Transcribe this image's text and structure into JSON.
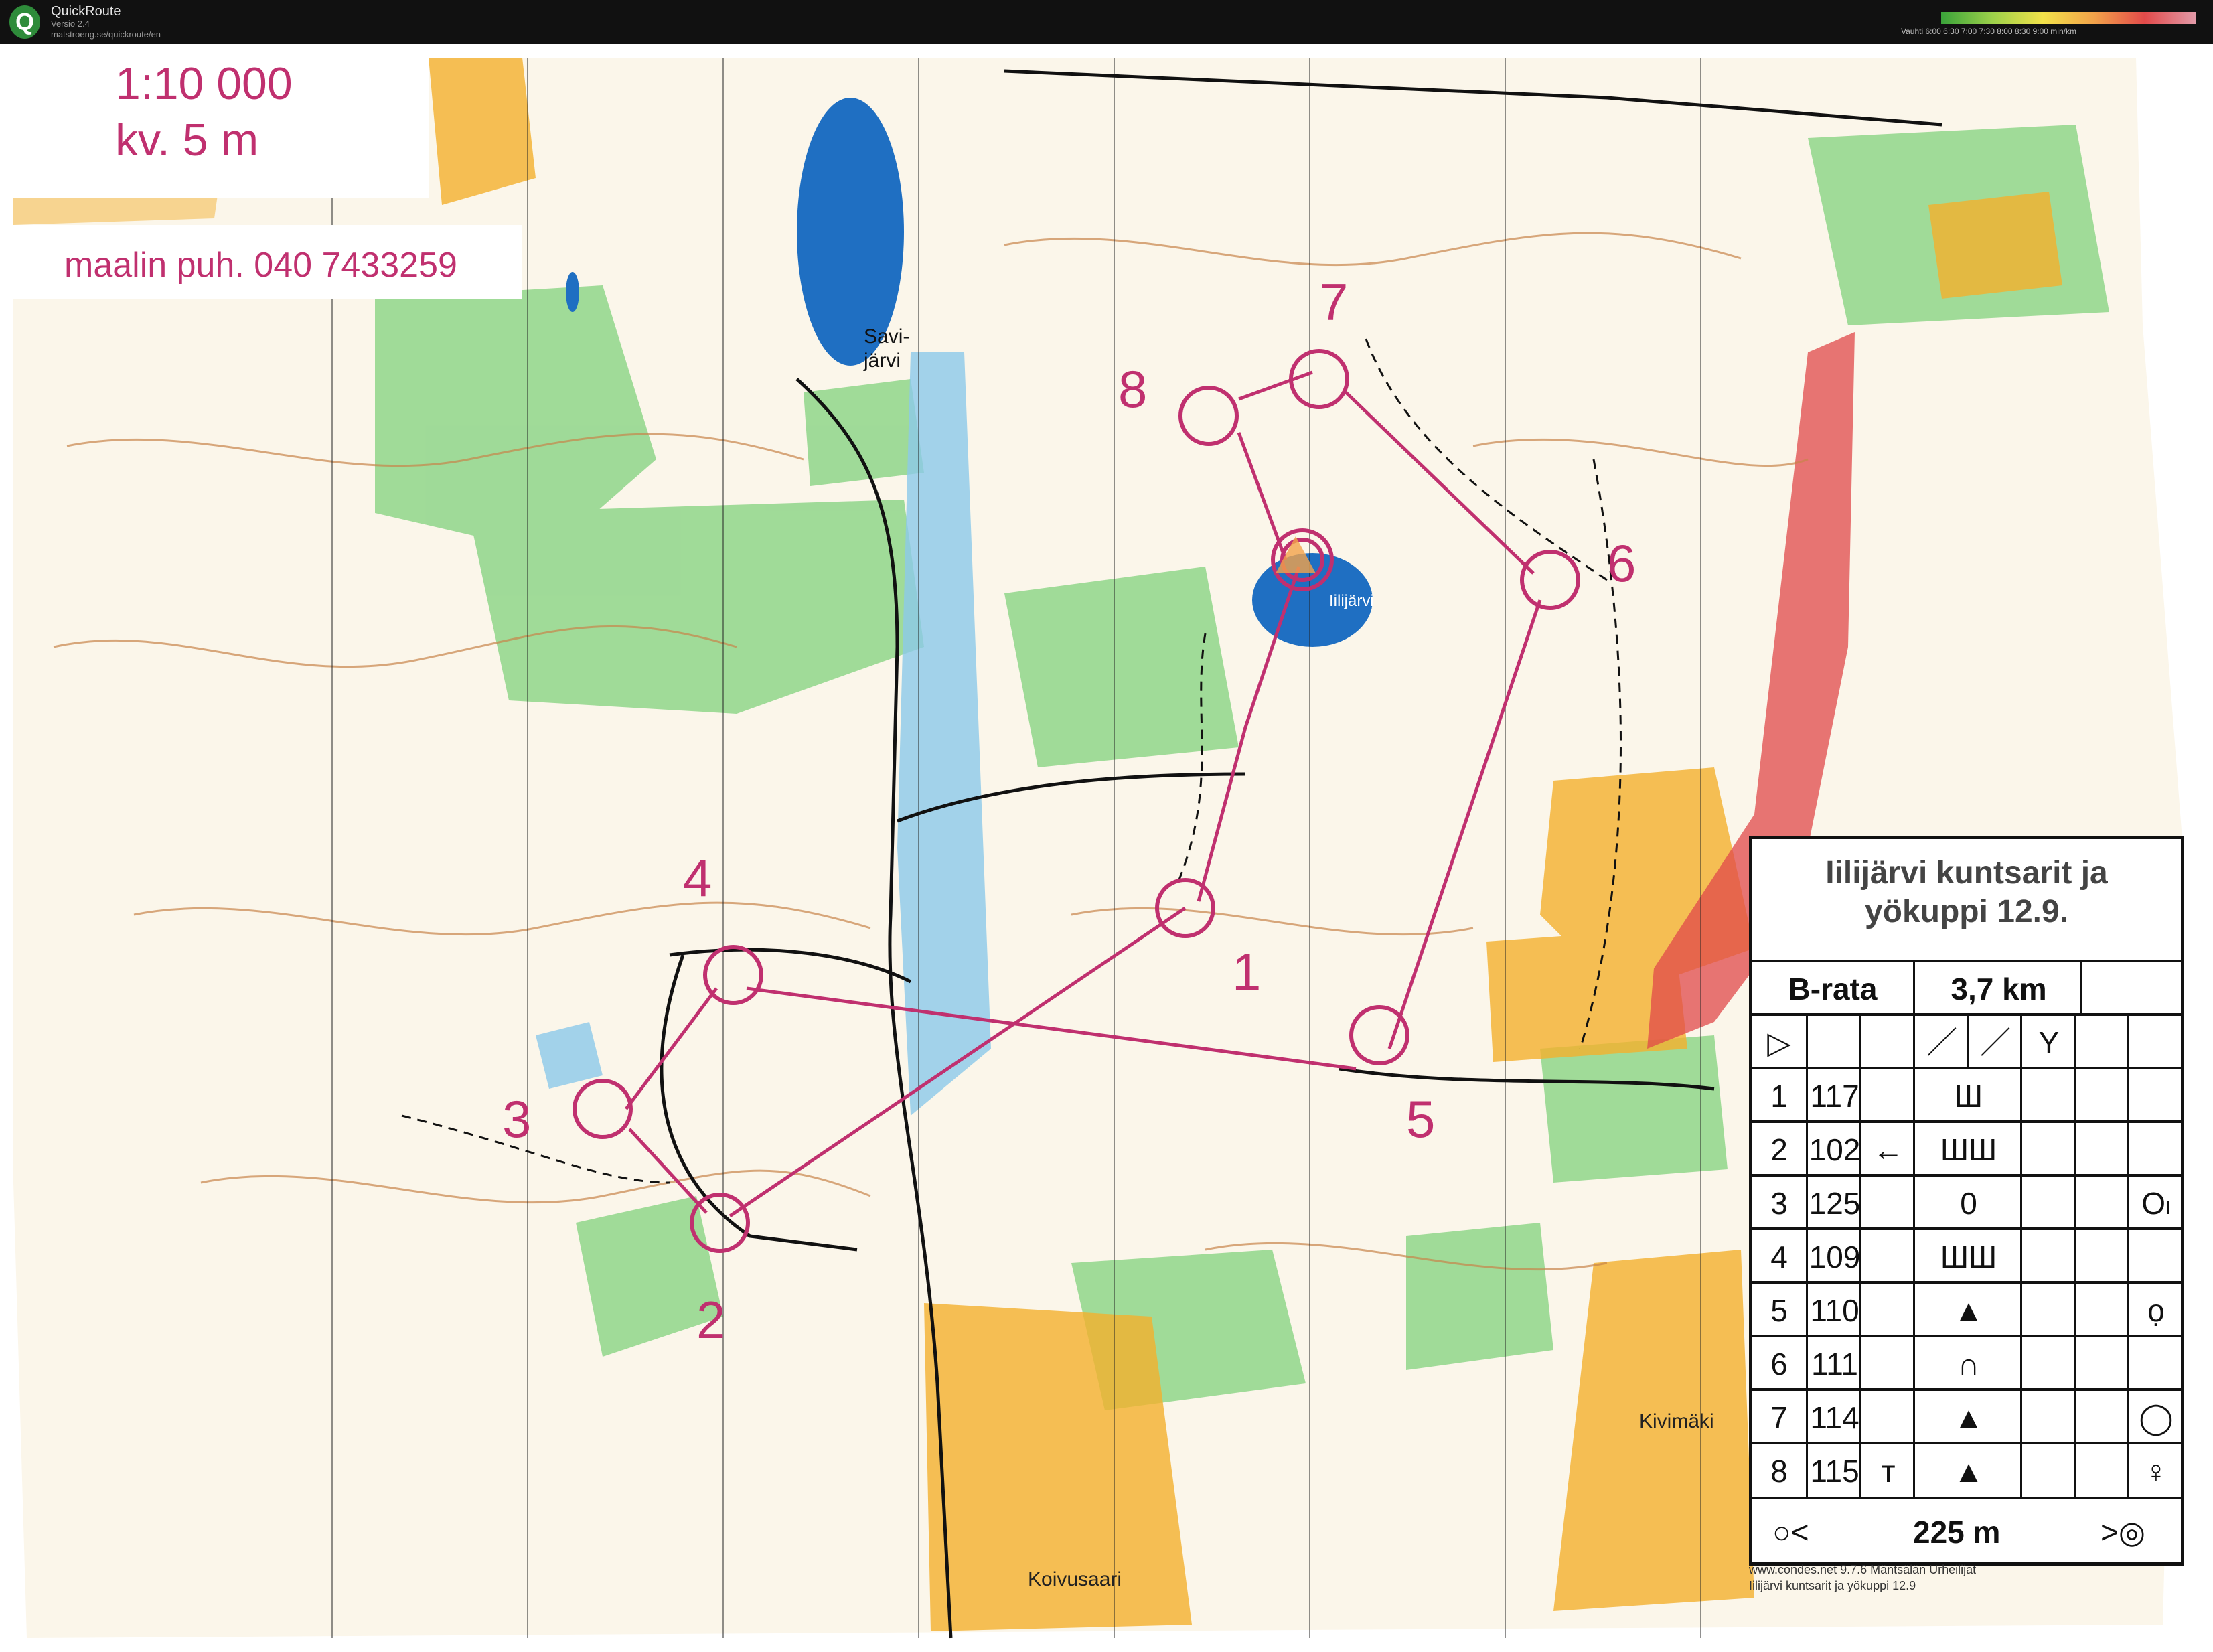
{
  "app": {
    "logo_letter": "Q",
    "name": "QuickRoute",
    "version": "Versio 2.4",
    "url": "matstroeng.se/quickroute/en"
  },
  "pace_legend": {
    "labels": "Vauhti 6:00   6:30   7:00   7:30   8:00   8:30   9:00 min/km",
    "colors": [
      "#3aa33a",
      "#9bd04a",
      "#f2e24a",
      "#f2a34a",
      "#e24a4a",
      "#e29aa8"
    ]
  },
  "map": {
    "scale": "1:10 000",
    "contour_interval": "kv. 5 m",
    "finish_phone": "maalin puh. 040 7433259",
    "places": {
      "lake_1_line1": "Savi-",
      "lake_1_line2": "järvi",
      "lake_2": "Iilijärvi",
      "village_1": "Kivimäki",
      "village_2": "Koivusaari"
    },
    "control_numbers": [
      "1",
      "2",
      "3",
      "4",
      "5",
      "6",
      "7",
      "8"
    ],
    "colors": {
      "course": "#c0306f",
      "water": "#1f6fc2",
      "forest_green": "#7fcf7a",
      "open_yellow": "#f4b12e",
      "contour": "#c8844a",
      "track": "#111111"
    }
  },
  "control_card": {
    "title_line1": "Iilijärvi kuntsarit ja",
    "title_line2": "yökuppi 12.9.",
    "course_name": "B-rata",
    "course_length": "3,7 km",
    "start_symbol": "▷",
    "header_symbols": [
      "／",
      "／",
      "Y"
    ],
    "rows": [
      {
        "num": "1",
        "code": "117",
        "extra": "",
        "feature": "Ш",
        "appearance": ""
      },
      {
        "num": "2",
        "code": "102",
        "extra": "←",
        "feature": "ШШ",
        "appearance": ""
      },
      {
        "num": "3",
        "code": "125",
        "extra": "",
        "feature": "0",
        "appearance": "Oₗ"
      },
      {
        "num": "4",
        "code": "109",
        "extra": "",
        "feature": "ШШ",
        "appearance": ""
      },
      {
        "num": "5",
        "code": "110",
        "extra": "",
        "feature": "▲",
        "appearance": "ọ"
      },
      {
        "num": "6",
        "code": "111",
        "extra": "",
        "feature": "∩",
        "appearance": ""
      },
      {
        "num": "7",
        "code": "114",
        "extra": "",
        "feature": "▲",
        "appearance": "◯"
      },
      {
        "num": "8",
        "code": "115",
        "extra": "ᴛ",
        "feature": "▲",
        "appearance": "♀"
      }
    ],
    "footer_left": "○<",
    "footer_distance": "225 m",
    "footer_right": ">◎"
  },
  "credits": {
    "line1": "www.condes.net 9.7.6 Mäntsälän Urheilijat",
    "line2": "Iilijärvi kuntsarit ja yökuppi 12.9"
  }
}
